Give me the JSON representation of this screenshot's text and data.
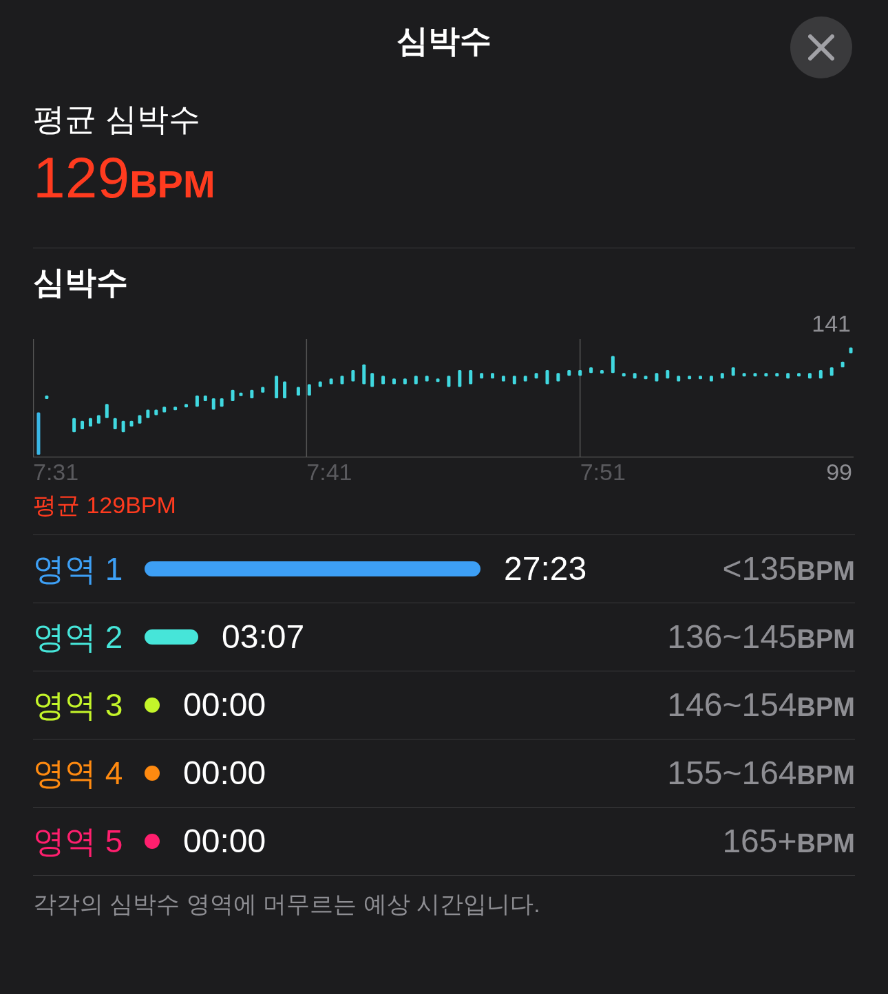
{
  "header": {
    "title": "심박수"
  },
  "average": {
    "label": "평균 심박수",
    "value": "129",
    "unit": "BPM"
  },
  "chart_section": {
    "title": "심박수",
    "y_max_label": "141",
    "y_min_label": "99",
    "time_labels": [
      "7:31",
      "7:41",
      "7:51"
    ],
    "avg_label": "평균 129BPM"
  },
  "zones": [
    {
      "label": "영역 1",
      "color": "#3d9ff5",
      "time": "27:23",
      "range": "<135",
      "unit": "BPM"
    },
    {
      "label": "영역 2",
      "color": "#46e5d9",
      "time": "03:07",
      "range": "136~145",
      "unit": "BPM"
    },
    {
      "label": "영역 3",
      "color": "#c4f52a",
      "time": "00:00",
      "range": "146~154",
      "unit": "BPM"
    },
    {
      "label": "영역 4",
      "color": "#ff8a10",
      "time": "00:00",
      "range": "155~164",
      "unit": "BPM"
    },
    {
      "label": "영역 5",
      "color": "#ff1f6e",
      "time": "00:00",
      "range": "165+",
      "unit": "BPM"
    }
  ],
  "footnote": "각각의 심박수 영역에 머무르는 예상 시간입니다."
}
